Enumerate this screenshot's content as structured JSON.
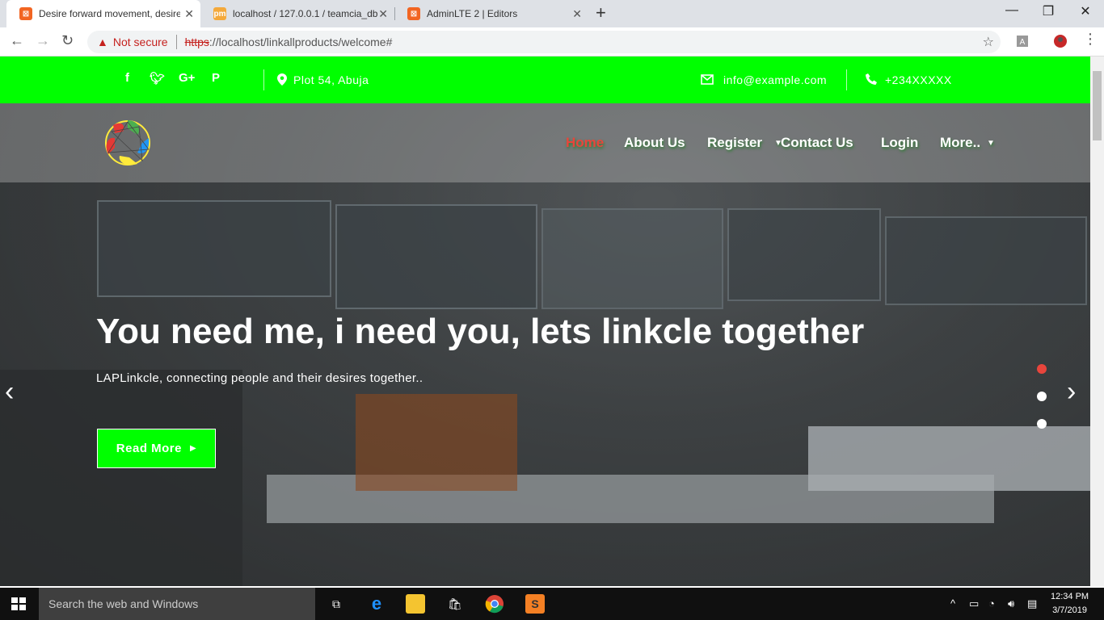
{
  "browser": {
    "tabs": [
      {
        "title": "Desire forward movement, desire",
        "active": true
      },
      {
        "title": "localhost / 127.0.0.1 / teamcia_db",
        "active": false
      },
      {
        "title": "AdminLTE 2 | Editors",
        "active": false
      }
    ],
    "security_label": "Not secure",
    "url_scheme": "https",
    "url_rest": "://localhost/linkallproducts/welcome#"
  },
  "topbar": {
    "address": "Plot 54, Abuja",
    "email": "info@example.com",
    "phone": "+234XXXXX"
  },
  "nav": {
    "items": [
      "Home",
      "About Us",
      "Register",
      "Contact Us",
      "Login",
      "More.."
    ]
  },
  "hero": {
    "headline": "You need me, i need you, lets  linkcle together",
    "subline": "LAPLinkcle, connecting people and their desires together..",
    "button": "Read More",
    "slides": 3,
    "active_slide": 1
  },
  "taskbar": {
    "search_placeholder": "Search the web and Windows",
    "time": "12:34 PM",
    "date": "3/7/2019"
  },
  "colors": {
    "brand_green": "#00ff00",
    "accent_red": "#e8453c"
  }
}
